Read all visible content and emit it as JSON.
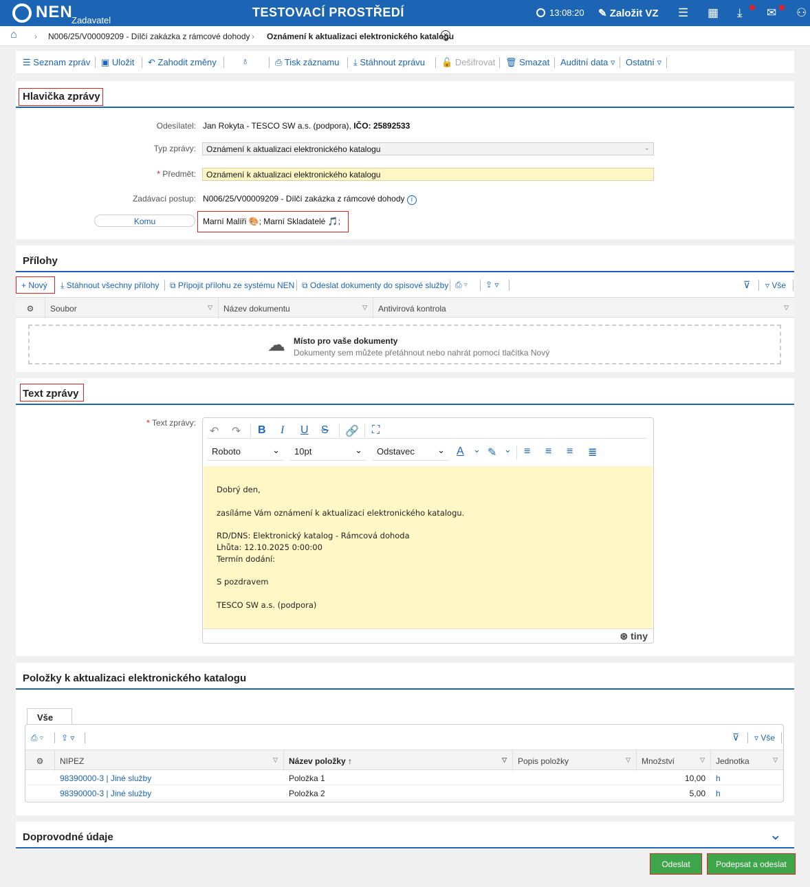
{
  "topbar": {
    "brand": "NEN",
    "brand_sub": "Zadavatel",
    "env_title": "TESTOVACÍ PROSTŘEDÍ",
    "time": "13:08:20",
    "create_label": "Založit VZ",
    "colors": {
      "bar": "#1c64b4",
      "badge": "#e0202a"
    },
    "icons": [
      "clock-icon",
      "edit-icon",
      "menu-icon",
      "calendar-icon",
      "download-icon",
      "mail-icon",
      "user-icon"
    ]
  },
  "breadcrumb": {
    "items": [
      "N006/25/V00009209 - Dílčí zakázka z rámcové dohody",
      "Oznámení k aktualizaci elektronického katalogu"
    ]
  },
  "toolbar": {
    "list": "Seznam zpráv",
    "save": "Uložit",
    "discard": "Zahodit změny",
    "print": "Tisk záznamu",
    "download": "Stáhnout zprávu",
    "decrypt": "Dešifrovat",
    "delete": "Smazat",
    "audit": "Auditní data",
    "other": "Ostatní"
  },
  "header_section": {
    "title": "Hlavička zprávy",
    "sender_label": "Odesílatel:",
    "sender_value": "Jan Rokyta - TESCO SW a.s. (podpora),",
    "ico_value": "IČO: 25892533",
    "type_label": "Typ zprávy:",
    "type_value": "Oznámení k aktualizaci elektronického katalogu",
    "subject_label": "Předmět:",
    "subject_value": "Oznámení k aktualizaci elektronického katalogu",
    "procedure_label": "Zadávací postup:",
    "procedure_value": "N006/25/V00009209 - Dílčí zakázka z rámcové dohody",
    "to_button": "Komu",
    "recipients": "Marní Malíři 🎨; Marní Skladatelé 🎵;"
  },
  "attachments": {
    "title": "Přílohy",
    "new": "Nový",
    "download_all": "Stáhnout všechny přílohy",
    "attach_nen": "Připojit přílohu ze systému NEN",
    "send_docs": "Odeslat dokumenty do spisové služby",
    "filter_all": "Vše",
    "columns": [
      "Soubor",
      "Název dokumentu",
      "Antivirová kontrola"
    ],
    "drop_title": "Místo pro vaše dokumenty",
    "drop_hint": "Dokumenty sem můžete přetáhnout nebo nahrát pomocí tlačítka Nový"
  },
  "message_text": {
    "title": "Text zprávy",
    "label": "Text zprávy:",
    "font": "Roboto",
    "size": "10pt",
    "block": "Odstavec",
    "lines": [
      "Dobrý den,",
      "",
      "zasíláme Vám oznámení k aktualizaci elektronického katalogu.",
      "",
      "RD/DNS: Elektronický katalog - Rámcová dohoda",
      "Lhůta: 12.10.2025 0:00:00",
      "Termín dodání:",
      "",
      "S pozdravem",
      "",
      "TESCO SW a.s. (podpora)"
    ],
    "brand": "tiny"
  },
  "items": {
    "title": "Položky k aktualizaci elektronického katalogu",
    "tab": "Vše",
    "filter_all": "Vše",
    "columns": [
      "NIPEZ",
      "Název položky",
      "Popis položky",
      "Množství",
      "Jednotka"
    ],
    "rows": [
      {
        "nipez": "98390000-3 | Jiné služby",
        "name": "Položka 1",
        "desc": "",
        "qty": "10,00",
        "unit": "h"
      },
      {
        "nipez": "98390000-3 | Jiné služby",
        "name": "Položka 2",
        "desc": "",
        "qty": "5,00",
        "unit": "h"
      }
    ]
  },
  "extra": {
    "title": "Doprovodné údaje"
  },
  "actions": {
    "send": "Odeslat",
    "sign_send": "Podepsat a odeslat"
  }
}
